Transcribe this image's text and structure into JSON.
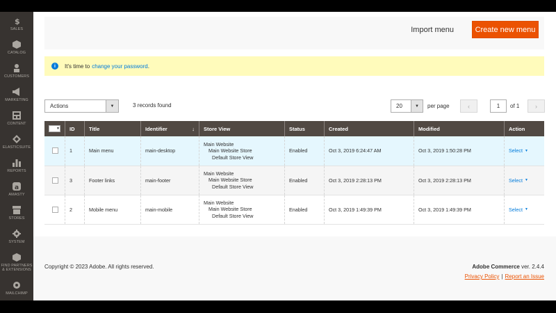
{
  "sidebar": {
    "items": [
      {
        "label": "SALES",
        "icon": "dollar-icon"
      },
      {
        "label": "CATALOG",
        "icon": "box-icon"
      },
      {
        "label": "CUSTOMERS",
        "icon": "person-icon"
      },
      {
        "label": "MARKETING",
        "icon": "megaphone-icon"
      },
      {
        "label": "CONTENT",
        "icon": "layout-icon"
      },
      {
        "label": "ELASTICSUITE",
        "icon": "elasticsuite-icon"
      },
      {
        "label": "REPORTS",
        "icon": "bar-chart-icon"
      },
      {
        "label": "AMASTY",
        "icon": "amasty-icon"
      },
      {
        "label": "STORES",
        "icon": "storefront-icon"
      },
      {
        "label": "SYSTEM",
        "icon": "gear-icon"
      },
      {
        "label": "FIND PARTNERS & EXTENSIONS",
        "icon": "puzzle-icon"
      },
      {
        "label": "MAILCHIMP",
        "icon": "chimp-icon"
      }
    ]
  },
  "page_actions": {
    "import_label": "Import menu",
    "create_label": "Create new menu"
  },
  "notice": {
    "text": "It's time to",
    "link": "change your password",
    "suffix": "."
  },
  "toolbar": {
    "actions_label": "Actions",
    "records_found": "3 records found",
    "per_page_value": "20",
    "per_page_label": "per page",
    "page_value": "1",
    "page_of": "of 1"
  },
  "table": {
    "columns": [
      "ID",
      "Title",
      "Identifier",
      "Store View",
      "Status",
      "Created",
      "Modified",
      "Action"
    ],
    "rows": [
      {
        "id": "1",
        "title": "Main menu",
        "identifier": "main-desktop",
        "store1": "Main Website",
        "store2": "Main Website Store",
        "store3": "Default Store View",
        "status": "Enabled",
        "created": "Oct 3, 2019 6:24:47 AM",
        "modified": "Oct 3, 2019 1:50:28 PM",
        "action": "Select"
      },
      {
        "id": "3",
        "title": "Footer links",
        "identifier": "main-footer",
        "store1": "Main Website",
        "store2": "Main Website Store",
        "store3": "Default Store View",
        "status": "Enabled",
        "created": "Oct 3, 2019 2:28:13 PM",
        "modified": "Oct 3, 2019 2:28:13 PM",
        "action": "Select"
      },
      {
        "id": "2",
        "title": "Mobile menu",
        "identifier": "main-mobile",
        "store1": "Main Website",
        "store2": "Main Website Store",
        "store3": "Default Store View",
        "status": "Enabled",
        "created": "Oct 3, 2019 1:49:39 PM",
        "modified": "Oct 3, 2019 1:49:39 PM",
        "action": "Select"
      }
    ]
  },
  "footer": {
    "copyright": "Copyright © 2023 Adobe. All rights reserved.",
    "brand": "Adobe Commerce",
    "version": "ver. 2.4.4",
    "privacy": "Privacy Policy",
    "separator": "|",
    "report": "Report an Issue"
  },
  "colors": {
    "accent": "#eb5202",
    "sidebar": "#373330",
    "header": "#514943",
    "link": "#007bdb",
    "notice": "#fffbbb"
  }
}
